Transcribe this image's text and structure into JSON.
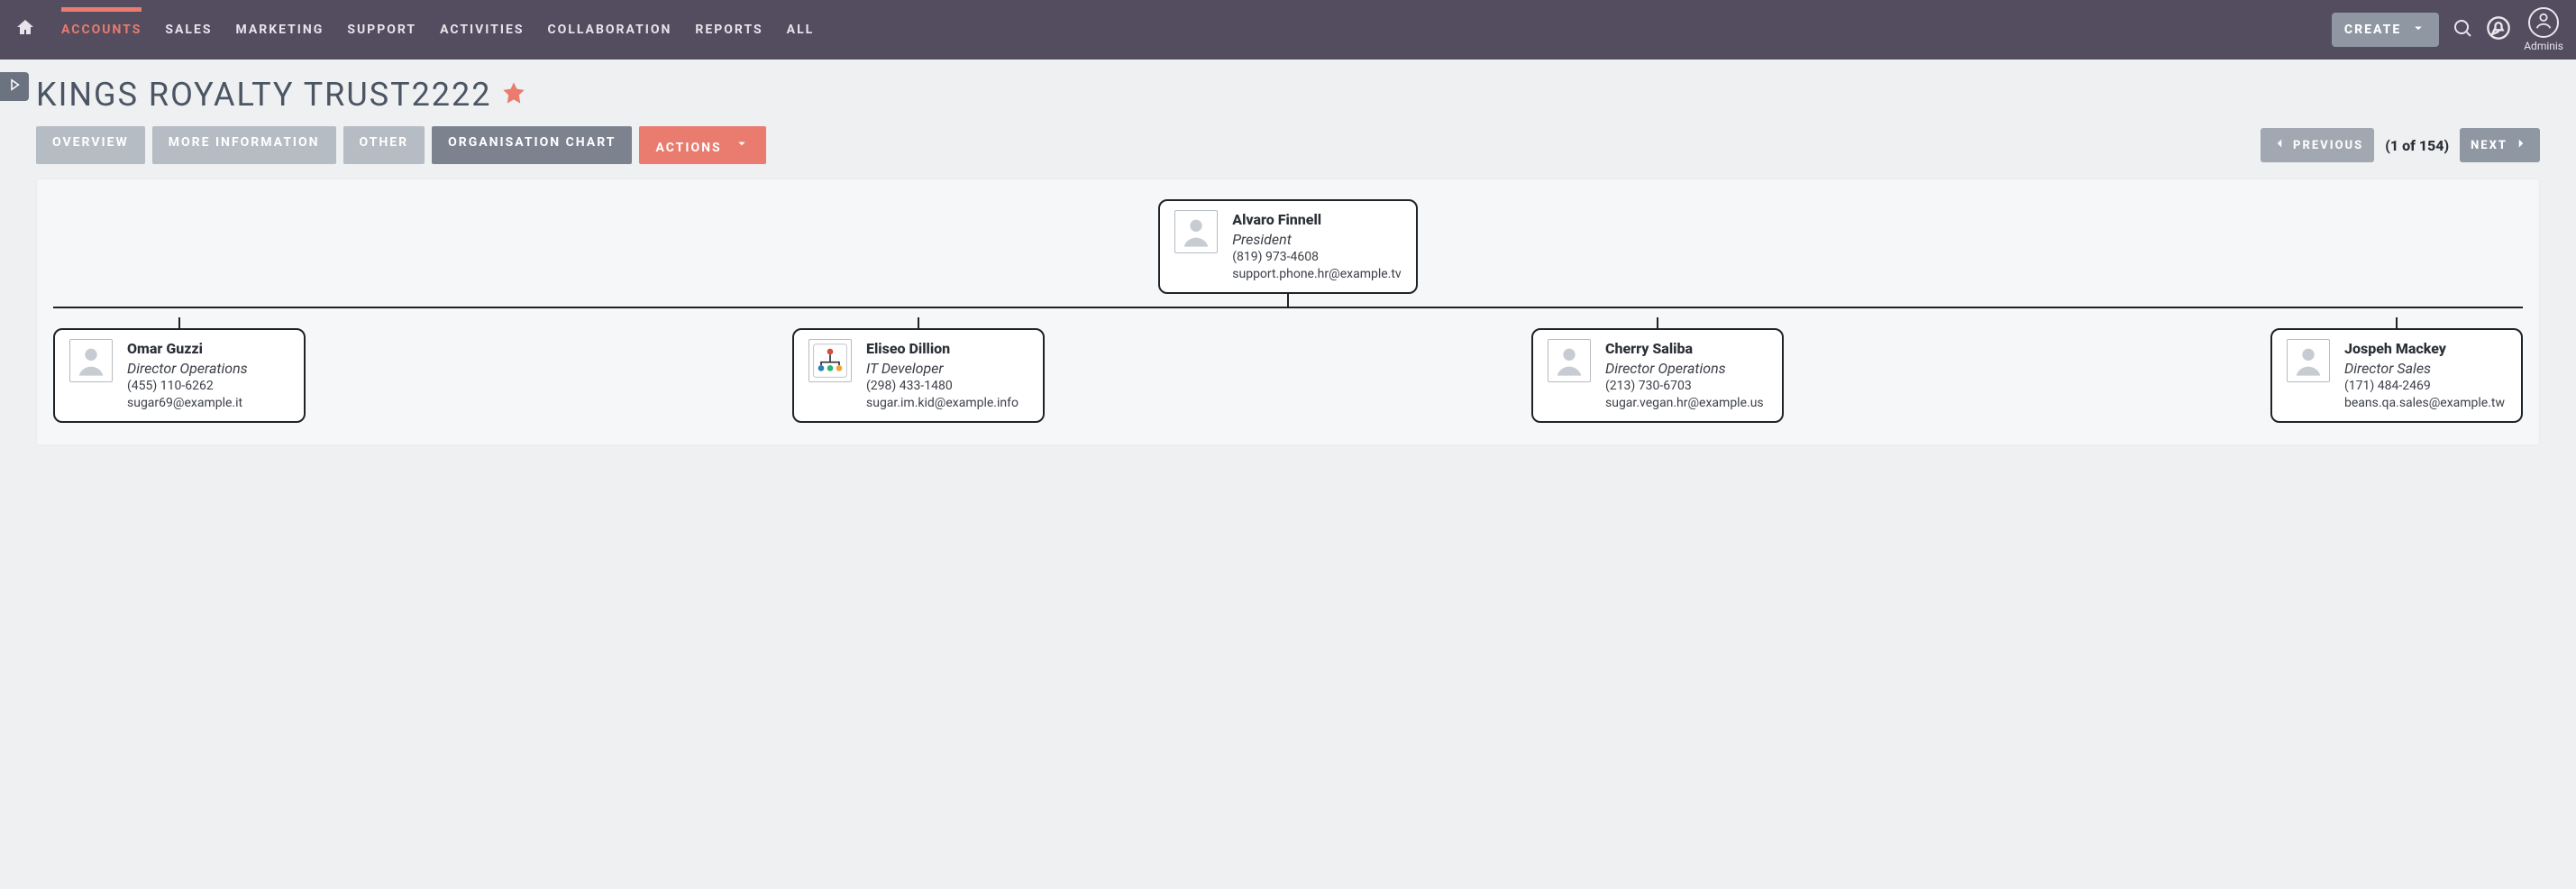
{
  "nav": {
    "items": [
      "ACCOUNTS",
      "SALES",
      "MARKETING",
      "SUPPORT",
      "ACTIVITIES",
      "COLLABORATION",
      "REPORTS",
      "ALL"
    ],
    "activeIndex": 0,
    "create_label": "CREATE",
    "admin_label": "Adminis"
  },
  "page": {
    "title": "KINGS ROYALTY TRUST2222"
  },
  "tabs": {
    "overview": "OVERVIEW",
    "more_info": "MORE INFORMATION",
    "other": "OTHER",
    "org_chart": "ORGANISATION CHART",
    "actions": "ACTIONS"
  },
  "pager": {
    "previous": "PREVIOUS",
    "count": "(1 of 154)",
    "next": "NEXT"
  },
  "org": {
    "root": {
      "name": "Alvaro Finnell",
      "title": "President",
      "phone": "(819) 973-4608",
      "email": "support.phone.hr@example.tv"
    },
    "children": [
      {
        "name": "Omar Guzzi",
        "title": "Director Operations",
        "phone": "(455) 110-6262",
        "email": "sugar69@example.it"
      },
      {
        "name": "Eliseo Dillion",
        "title": "IT Developer",
        "phone": "(298) 433-1480",
        "email": "sugar.im.kid@example.info"
      },
      {
        "name": "Cherry Saliba",
        "title": "Director Operations",
        "phone": "(213) 730-6703",
        "email": "sugar.vegan.hr@example.us"
      },
      {
        "name": "Jospeh Mackey",
        "title": "Director Sales",
        "phone": "(171) 484-2469",
        "email": "beans.qa.sales@example.tw"
      }
    ]
  },
  "icons": {
    "home": "home-icon",
    "caret": "chevron-down-icon",
    "search": "search-icon",
    "chat": "chat-icon",
    "bell": "bell-icon",
    "user": "user-icon",
    "triangle": "triangle-right-icon",
    "star": "star-icon",
    "chev_left": "chevron-left-icon",
    "chev_right": "chevron-right-icon"
  }
}
